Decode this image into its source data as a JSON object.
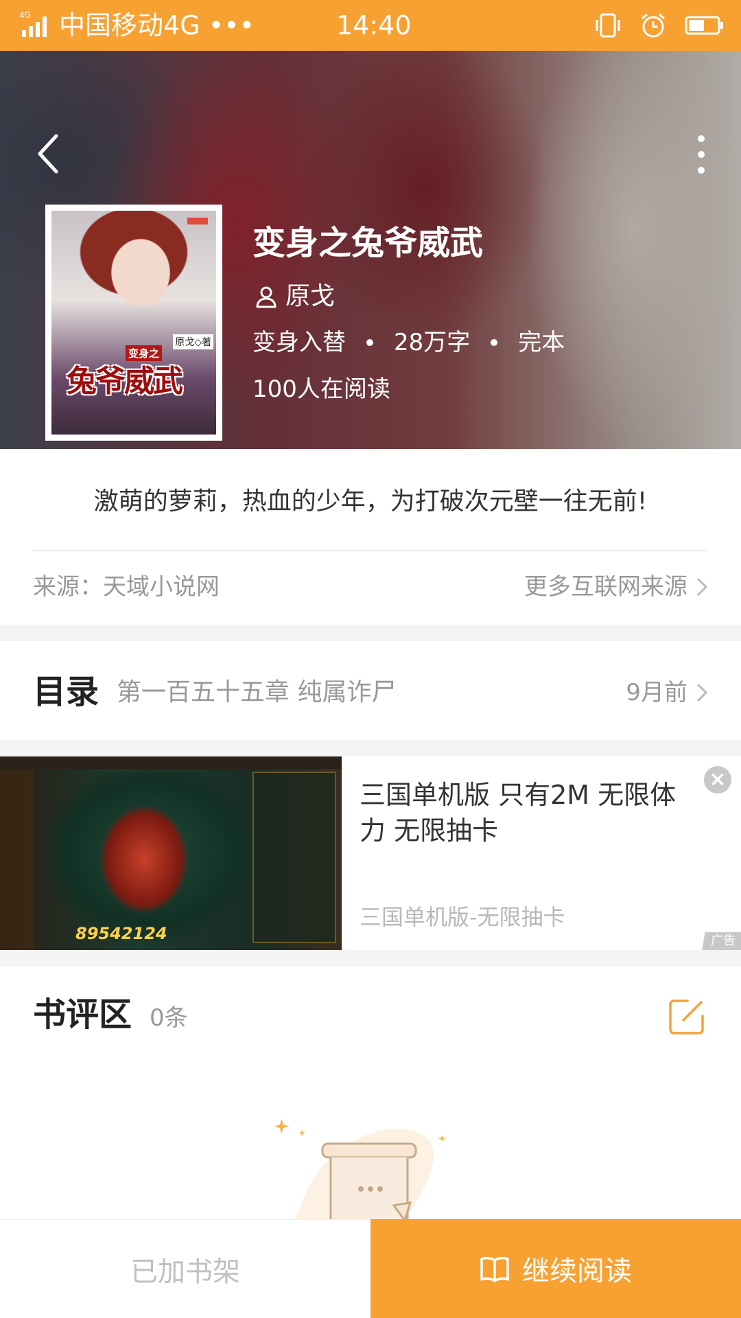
{
  "status_bar": {
    "network": "4G",
    "carrier": "中国移动4G •••",
    "time": "14:40",
    "icons": [
      "vibrate-icon",
      "alarm-icon",
      "battery-icon"
    ]
  },
  "header": {
    "back_icon": "chevron-left-icon",
    "more_icon": "more-vertical-icon",
    "cover": {
      "title_small": "变身之",
      "title": "兔爷威武",
      "author_tag": "原戈◇著"
    },
    "title": "变身之兔爷威武",
    "author": "原戈",
    "category": "变身入替",
    "word_count": "28万字",
    "status": "完本",
    "readers": "100人在阅读"
  },
  "intro": {
    "text": "激萌的萝莉，热血的少年，为打破次元壁一往无前!",
    "source": "来源：天域小说网",
    "more_sources": "更多互联网来源"
  },
  "catalog": {
    "title": "目录",
    "latest_chapter": "第一百五十五章 纯属诈尸",
    "updated": "9月前"
  },
  "ad": {
    "title": "三国单机版 只有2M 无限体力 无限抽卡",
    "subtitle": "三国单机版-无限抽卡",
    "tag": "广告",
    "image_score": "89542124"
  },
  "reviews": {
    "title": "书评区",
    "count": "0条"
  },
  "bottom_bar": {
    "shelf_label": "已加书架",
    "read_label": "继续阅读"
  },
  "colors": {
    "accent": "#f7a133",
    "text_primary": "#222222",
    "text_secondary": "#999999"
  }
}
